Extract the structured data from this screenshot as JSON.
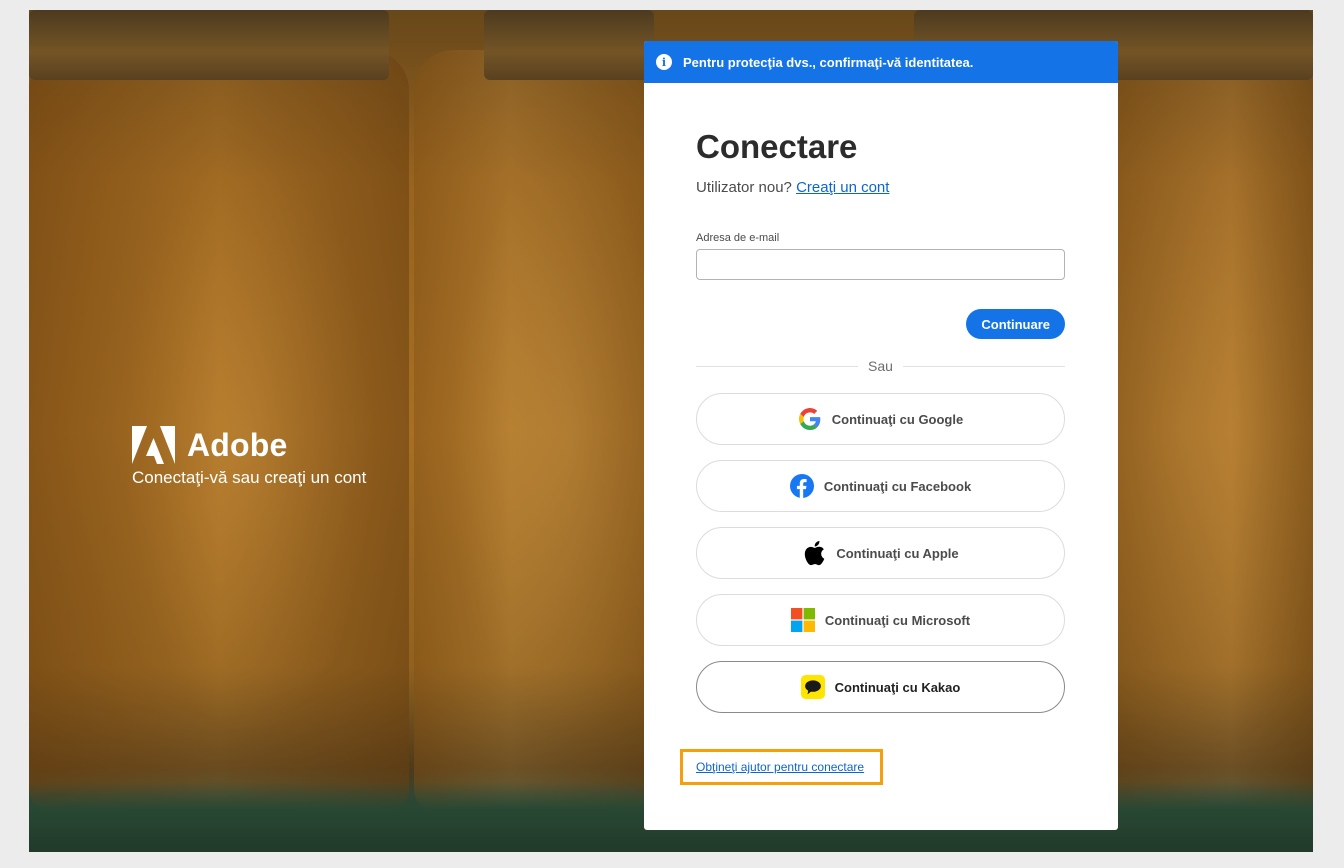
{
  "background": {
    "scene": "honey-jars-photo"
  },
  "brand": {
    "logo_icon": "adobe-logo-icon",
    "name": "Adobe",
    "tagline": "Conectaţi-vă sau creaţi un cont"
  },
  "banner": {
    "icon": "info-icon",
    "text": "Pentru protecţia dvs., confirmaţi-vă identitatea.",
    "color": "#1473e6"
  },
  "signin": {
    "title": "Conectare",
    "new_user_text": "Utilizator nou?",
    "create_account_link": "Creaţi un cont",
    "email_label": "Adresa de e-mail",
    "email_value": "",
    "email_placeholder": "",
    "continue_label": "Continuare",
    "or_text": "Sau"
  },
  "social": [
    {
      "id": "google",
      "icon": "google-icon",
      "label": "Continuaţi cu Google"
    },
    {
      "id": "facebook",
      "icon": "facebook-icon",
      "label": "Continuaţi cu Facebook"
    },
    {
      "id": "apple",
      "icon": "apple-icon",
      "label": "Continuaţi cu Apple"
    },
    {
      "id": "microsoft",
      "icon": "microsoft-icon",
      "label": "Continuaţi cu Microsoft"
    },
    {
      "id": "kakao",
      "icon": "kakao-icon",
      "label": "Continuaţi cu Kakao"
    }
  ],
  "help": {
    "link_text": "Obţineţi ajutor pentru conectare",
    "highlight_color": "#f5a00a"
  },
  "colors": {
    "accent": "#1473e6",
    "link": "#0d66d0"
  }
}
